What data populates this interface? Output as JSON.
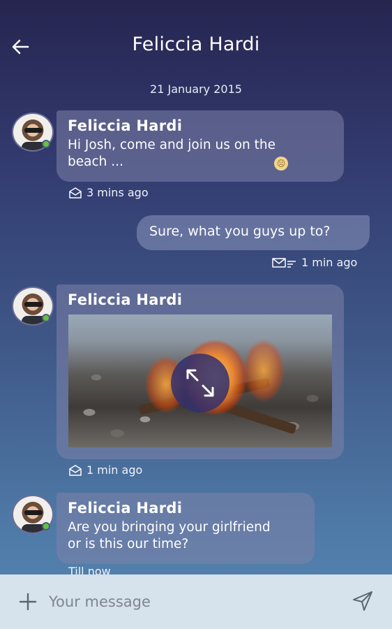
{
  "header": {
    "title": "Feliccia Hardi",
    "back_icon": "arrow-left-icon"
  },
  "date_label": "21 January 2015",
  "messages": [
    {
      "sender": "Feliccia Hardi",
      "text": "Hi Josh, come and join us on the\nbeach ...",
      "meta": "3 mins ago",
      "emoji": "sad-face-icon"
    },
    {
      "text": "Sure, what you guys up to?",
      "meta": "1 min ago"
    },
    {
      "sender": "Feliccia Hardi",
      "image": "campfire-photo",
      "meta": "1 min ago"
    },
    {
      "sender": "Feliccia Hardi",
      "text": "Are you bringing your girlfriend\n or is this our time?",
      "meta": "Till now"
    }
  ],
  "composer": {
    "placeholder": "Your message",
    "value": ""
  },
  "colors": {
    "online": "#67c23a",
    "composer_bg": "#d6e2ec"
  }
}
